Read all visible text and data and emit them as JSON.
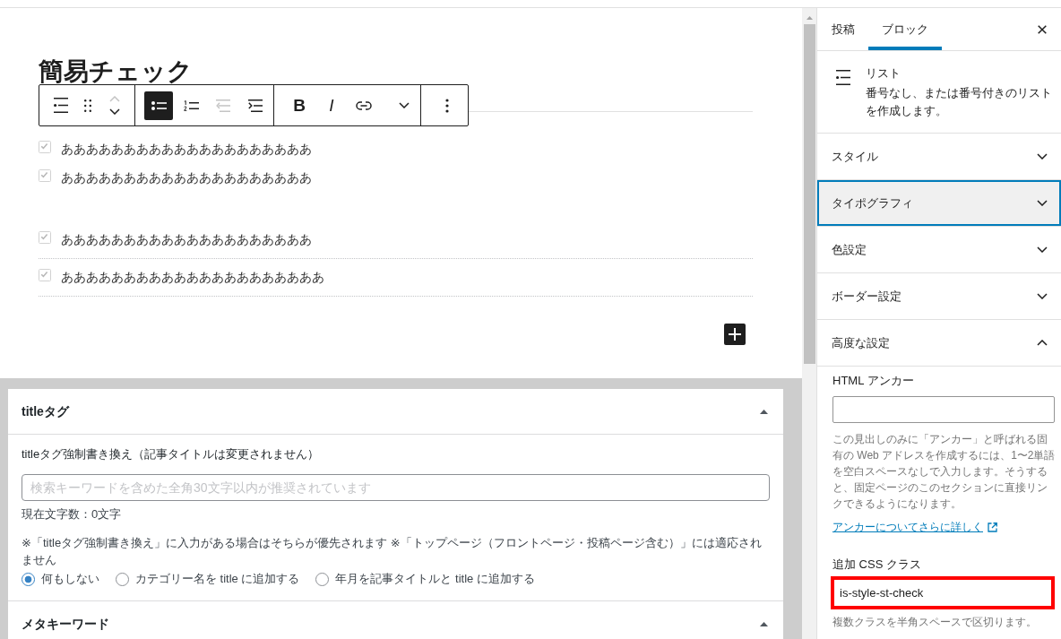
{
  "editor": {
    "heading": "簡易チェック",
    "toolbar": {
      "groups": [
        {
          "items": [
            {
              "kind": "block-type"
            },
            {
              "kind": "drag"
            },
            {
              "kind": "move-up",
              "disabled": true
            },
            {
              "kind": "move-down",
              "disabled": false
            }
          ]
        },
        {
          "items": [
            {
              "kind": "bullet-list",
              "selected": true
            },
            {
              "kind": "numbered-list",
              "selected": false
            },
            {
              "kind": "outdent",
              "disabled": true
            },
            {
              "kind": "indent",
              "disabled": false
            }
          ]
        },
        {
          "items": [
            {
              "kind": "bold",
              "label": "B"
            },
            {
              "kind": "italic",
              "label": "I"
            },
            {
              "kind": "link"
            },
            {
              "kind": "more-formats"
            }
          ]
        },
        {
          "items": [
            {
              "kind": "options"
            }
          ]
        }
      ]
    },
    "lists": [
      {
        "kind": "plain",
        "items": [
          "ああああああああああああああああああああ",
          "ああああああああああああああああああああ"
        ]
      },
      {
        "kind": "dotted",
        "items": [
          "ああああああああああああああああああああ",
          "あああああああああああああああああああああ"
        ]
      }
    ]
  },
  "meta_boxes": [
    {
      "title": "titleタグ",
      "expanded": true,
      "body": {
        "label": "titleタグ強制書き換え（記事タイトルは変更されません）",
        "placeholder": "検索キーワードを含めた全角30文字以内が推奨されています",
        "count": "現在文字数：0文字",
        "note": "※「titleタグ強制書き換え」に入力がある場合はそちらが優先されます ※「トップページ（フロントページ・投稿ページ含む）」には適応されません",
        "options": [
          {
            "label": "何もしない",
            "selected": true
          },
          {
            "label": "カテゴリー名を title に追加する",
            "selected": false
          },
          {
            "label": "年月を記事タイトルと title に追加する",
            "selected": false
          }
        ]
      }
    },
    {
      "title": "メタキーワード",
      "expanded": true
    }
  ],
  "sidebar": {
    "tabs": [
      {
        "label": "投稿",
        "selected": false
      },
      {
        "label": "ブロック",
        "selected": true
      }
    ],
    "block_card": {
      "title": "リスト",
      "description": "番号なし、または番号付きのリストを作成します。"
    },
    "panels": [
      {
        "title": "スタイル",
        "expanded": false,
        "focused": false
      },
      {
        "title": "タイポグラフィ",
        "expanded": false,
        "focused": true
      },
      {
        "title": "色設定",
        "expanded": false,
        "focused": false
      },
      {
        "title": "ボーダー設定",
        "expanded": false,
        "focused": false
      },
      {
        "title": "高度な設定",
        "expanded": true,
        "focused": false,
        "fields": {
          "anchor_label": "HTML アンカー",
          "anchor_help": "この見出しのみに「アンカー」と呼ばれる固有の Web アドレスを作成するには、1〜2単語を空白スペースなしで入力します。そうすると、固定ページのこのセクションに直接リンクできるようになります。",
          "help_link": "アンカーについてさらに詳しく",
          "css_label": "追加 CSS クラス",
          "css_value": "is-style-st-check",
          "css_highlighted": true,
          "css_help": "複数クラスを半角スペースで区切ります。"
        }
      }
    ]
  }
}
